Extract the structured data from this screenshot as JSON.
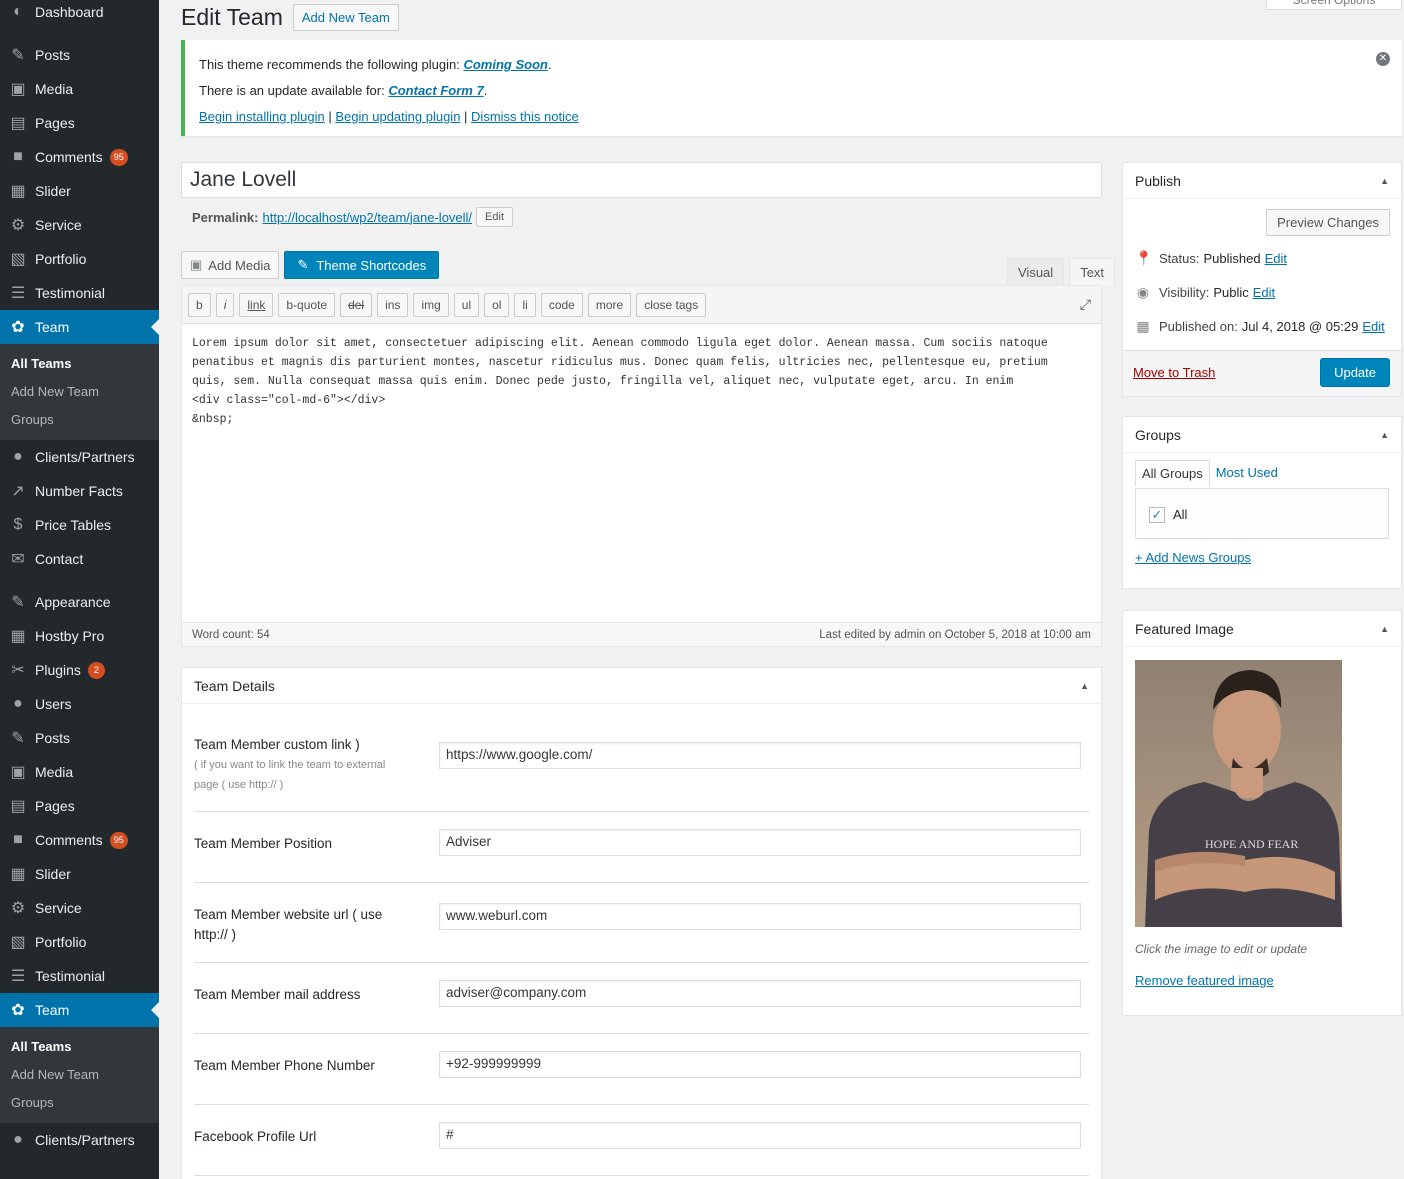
{
  "sidebar": {
    "items": [
      {
        "label": "Dashboard",
        "icon": "dashboard-icon",
        "glyph": "◐"
      },
      {
        "label": "Posts",
        "icon": "pin-icon",
        "glyph": "✎"
      },
      {
        "label": "Media",
        "icon": "media-icon",
        "glyph": "▣"
      },
      {
        "label": "Pages",
        "icon": "pages-icon",
        "glyph": "▤"
      },
      {
        "label": "Comments",
        "icon": "comment-icon",
        "glyph": "■",
        "badge": "95"
      },
      {
        "label": "Slider",
        "icon": "slider-icon",
        "glyph": "▦"
      },
      {
        "label": "Service",
        "icon": "gear-icon",
        "glyph": "⚙"
      },
      {
        "label": "Portfolio",
        "icon": "portfolio-icon",
        "glyph": "▧"
      },
      {
        "label": "Testimonial",
        "icon": "list-icon",
        "glyph": "☰"
      },
      {
        "label": "Team",
        "icon": "team-icon",
        "glyph": "✿",
        "current": true
      }
    ],
    "submenu": [
      "All Teams",
      "Add New Team",
      "Groups"
    ],
    "items2": [
      {
        "label": "Clients/Partners",
        "icon": "user-icon",
        "glyph": "●"
      },
      {
        "label": "Number Facts",
        "icon": "chart-icon",
        "glyph": "↗"
      },
      {
        "label": "Price Tables",
        "icon": "dollar-icon",
        "glyph": "$"
      },
      {
        "label": "Contact",
        "icon": "mail-icon",
        "glyph": "✉"
      }
    ],
    "items3": [
      {
        "label": "Appearance",
        "icon": "brush-icon",
        "glyph": "✎"
      },
      {
        "label": "Hostby Pro",
        "icon": "table-icon",
        "glyph": "▦"
      },
      {
        "label": "Plugins",
        "icon": "plugin-icon",
        "glyph": "✂",
        "badge": "2"
      },
      {
        "label": "Users",
        "icon": "user-icon",
        "glyph": "●"
      },
      {
        "label": "Posts",
        "icon": "pin-icon",
        "glyph": "✎"
      },
      {
        "label": "Media",
        "icon": "media-icon",
        "glyph": "▣"
      },
      {
        "label": "Pages",
        "icon": "pages-icon",
        "glyph": "▤"
      },
      {
        "label": "Comments",
        "icon": "comment-icon",
        "glyph": "■",
        "badge": "95"
      },
      {
        "label": "Slider",
        "icon": "slider-icon",
        "glyph": "▦"
      },
      {
        "label": "Service",
        "icon": "gear-icon",
        "glyph": "⚙"
      },
      {
        "label": "Portfolio",
        "icon": "portfolio-icon",
        "glyph": "▧"
      },
      {
        "label": "Testimonial",
        "icon": "list-icon",
        "glyph": "☰"
      },
      {
        "label": "Team",
        "icon": "team-icon",
        "glyph": "✿",
        "current": true
      }
    ],
    "submenu2": [
      "All Teams",
      "Add New Team",
      "Groups"
    ],
    "items4": [
      {
        "label": "Clients/Partners",
        "icon": "user-icon",
        "glyph": "●"
      }
    ]
  },
  "header": {
    "title": "Edit Team",
    "add_new": "Add New Team",
    "screen_options": "Screen Options"
  },
  "notice": {
    "line1_pre": "This theme recommends the following plugin: ",
    "line1_link": "Coming Soon",
    "line1_post": ".",
    "line2_pre": "There is an update available for: ",
    "line2_link": "Contact Form 7",
    "line2_post": ".",
    "action1": "Begin installing plugin",
    "action2": "Begin updating plugin",
    "action3": "Dismiss this notice",
    "sep": " | "
  },
  "post": {
    "title": "Jane Lovell",
    "permalink_label": "Permalink:",
    "permalink_url": "http://localhost/wp2/team/jane-lovell/",
    "edit": "Edit"
  },
  "editor": {
    "add_media": "Add Media",
    "theme_shortcodes": "Theme Shortcodes",
    "tab_visual": "Visual",
    "tab_text": "Text",
    "quicktags": [
      "b",
      "i",
      "link",
      "b-quote",
      "del",
      "ins",
      "img",
      "ul",
      "ol",
      "li",
      "code",
      "more",
      "close tags"
    ],
    "content": "Lorem ipsum dolor sit amet, consectetuer adipiscing elit. Aenean commodo ligula eget dolor. Aenean massa. Cum sociis natoque\npenatibus et magnis dis parturient montes, nascetur ridiculus mus. Donec quam felis, ultricies nec, pellentesque eu, pretium\nquis, sem. Nulla consequat massa quis enim. Donec pede justo, fringilla vel, aliquet nec, vulputate eget, arcu. In enim\n<div class=\"col-md-6\"></div>\n&nbsp;",
    "word_count": "Word count: 54",
    "last_edited": "Last edited by admin on October 5, 2018 at 10:00 am"
  },
  "team_details": {
    "title": "Team Details",
    "fields": [
      {
        "label": "Team Member custom link )",
        "hint": "( if you want to link the team to external page ( use http:// )",
        "value": "https://www.google.com/"
      },
      {
        "label": "Team Member Position",
        "value": "Adviser"
      },
      {
        "label": "Team Member website url ( use http:// )",
        "value": "www.weburl.com"
      },
      {
        "label": "Team Member mail address",
        "value": "adviser@company.com"
      },
      {
        "label": "Team Member Phone Number",
        "value": "+92-999999999"
      },
      {
        "label": "Facebook Profile Url",
        "value": "#"
      }
    ]
  },
  "publish": {
    "title": "Publish",
    "preview": "Preview Changes",
    "status_label": "Status:",
    "status": "Published",
    "visibility_label": "Visibility:",
    "visibility": "Public",
    "published_label": "Published on:",
    "published": "Jul 4, 2018 @ 05:29",
    "edit": "Edit",
    "trash": "Move to Trash",
    "update": "Update"
  },
  "groups": {
    "title": "Groups",
    "tab_all": "All Groups",
    "tab_used": "Most Used",
    "item": "All",
    "add": "+ Add News Groups"
  },
  "featured": {
    "title": "Featured Image",
    "caption": "Click the image to edit or update",
    "remove": "Remove featured image",
    "shirt_text": "HOPE AND FEAR"
  }
}
